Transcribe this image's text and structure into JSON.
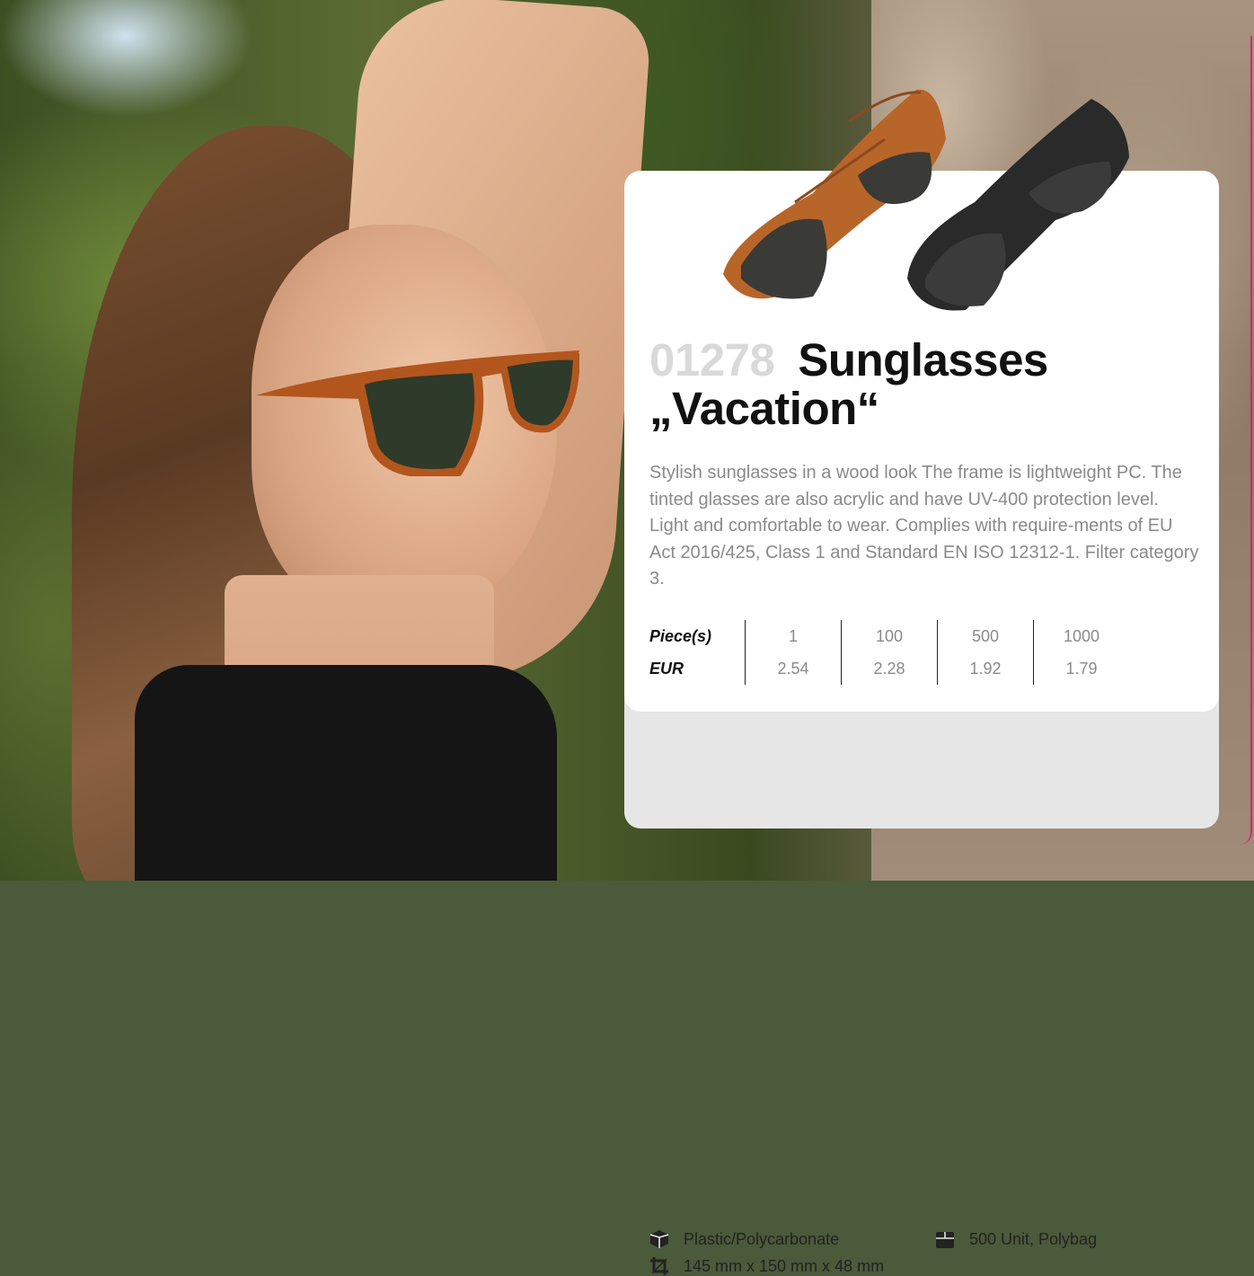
{
  "product": {
    "code": "01278",
    "title_line1": "Sunglasses",
    "title_line2": "„Vacation“",
    "description": "Stylish sunglasses in a wood look The frame is lightweight PC. The tinted glasses are also acrylic and have UV-400 protection level. Light and comfortable to wear. Complies with require-ments of EU Act 2016/425, Class 1 and Standard EN ISO 12312-1. Filter category 3."
  },
  "pricing": {
    "quantity_label": "Piece(s)",
    "currency_label": "EUR",
    "quantities": [
      "1",
      "100",
      "500",
      "1000"
    ],
    "prices": [
      "2.54",
      "2.28",
      "1.92",
      "1.79"
    ]
  },
  "specs": {
    "material": "Plastic/Polycarbonate",
    "dimensions": "145 mm x 150 mm x 48 mm",
    "packaging": "500 Unit, Polybag",
    "material_icon": "box-icon",
    "dimensions_icon": "crop-icon",
    "packaging_icon": "carton-icon"
  },
  "colors": {
    "accent": "#d4147a",
    "code_color": "#d9d9d9",
    "card_bg": "#ffffff",
    "spec_bg": "#e6e6e6"
  }
}
